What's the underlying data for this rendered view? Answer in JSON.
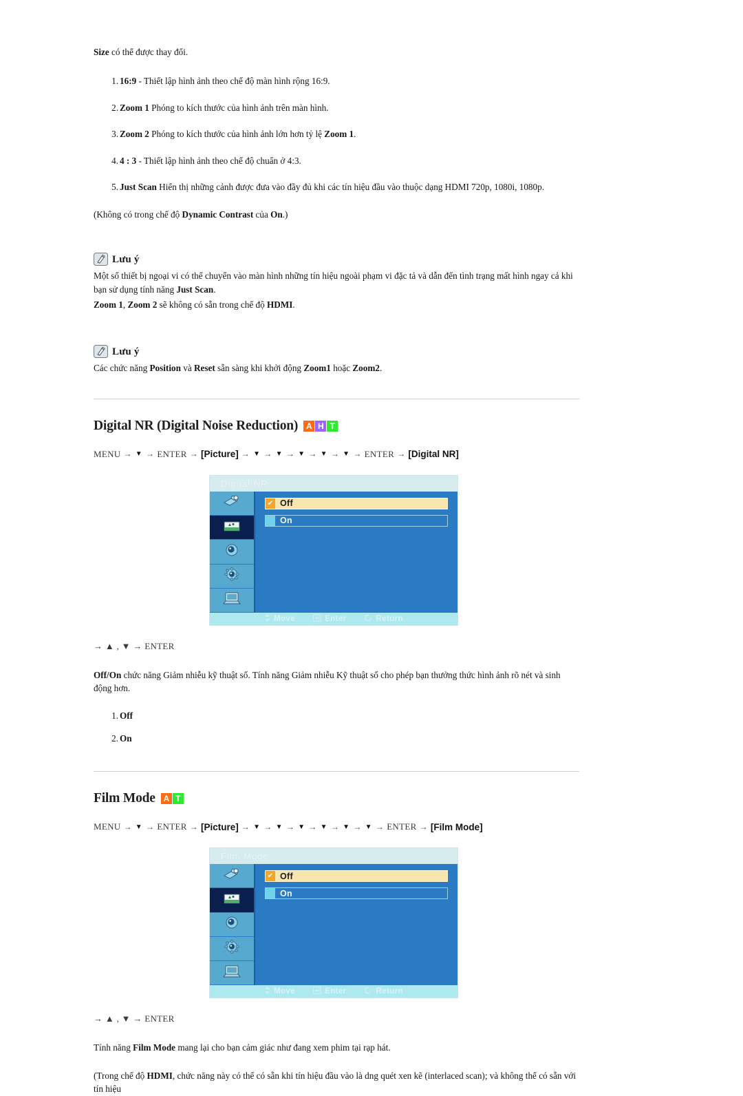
{
  "intro": {
    "lead_bold": "Size",
    "lead_rest": " có thể được thay đổi."
  },
  "size_options": [
    {
      "num": "1.",
      "bold": "16:9",
      "rest": " - Thiết lập hình ảnh theo chế độ màn hình rộng 16:9."
    },
    {
      "num": "2.",
      "bold": "Zoom 1",
      "rest": " Phóng to kích thước của hình ảnh trên màn hình."
    },
    {
      "num": "3.",
      "bold": "Zoom 2",
      "rest": " Phóng to kích thước của hình ảnh lớn hơn tỷ lệ ",
      "bold2": "Zoom 1",
      "rest2": "."
    },
    {
      "num": "4.",
      "bold": "4 : 3",
      "rest": " - Thiết lập hình ảnh theo chế độ chuẩn ở 4:3."
    },
    {
      "num": "5.",
      "bold": "Just Scan",
      "rest": " Hiển thị những cảnh được đưa vào đầy đủ khi các tín hiệu đầu vào thuộc dạng HDMI 720p, 1080i, 1080p."
    }
  ],
  "dynamic_note": {
    "pre": "(Không có trong chế độ ",
    "bold": "Dynamic Contrast",
    "mid": " của ",
    "bold2": "On",
    "post": ".)"
  },
  "notes": [
    {
      "title": "Lưu ý",
      "icon": "note-pencil-icon",
      "lines": [
        {
          "text": "Một số thiết bị ngoại vi có thể chuyển vào màn hình những tín hiệu ngoài phạm vi đặc tả và dẫn đến tình trạng mất hình ngay cả khi bạn sử dụng tính năng ",
          "bold": "Just Scan",
          "after": "."
        },
        {
          "bold_lead": "Zoom 1",
          "text": ", ",
          "bold_lead2": "Zoom 2",
          "text2": " sẽ không có sẵn trong chế độ ",
          "bold3": "HDMI",
          "after": "."
        }
      ]
    },
    {
      "title": "Lưu ý",
      "icon": "note-pencil-icon",
      "lines": [
        {
          "text": "Các chức năng ",
          "bold": "Position",
          "text2": " và ",
          "bold2": "Reset",
          "text3": " sẵn sàng khi khởi động ",
          "bold3": "Zoom1",
          "text4": " hoặc ",
          "bold4": "Zoom2",
          "after": "."
        }
      ]
    }
  ],
  "badge_colors": {
    "A": "#ff6a13",
    "H": "#9966ff",
    "T": "#2eea2e"
  },
  "sections": [
    {
      "id": "digital-nr",
      "heading": "Digital NR (Digital Noise Reduction)",
      "badges": [
        "A",
        "H",
        "T"
      ],
      "path": {
        "menu": "MENU",
        "enter": "ENTER",
        "bracket1": "[Picture]",
        "down_count": 5,
        "bracket2": "[Digital NR]"
      },
      "osd": {
        "title": "Digital  NR",
        "rail_icons": [
          "input-source-icon",
          "picture-icon",
          "sound-icon",
          "setup-gear-icon",
          "multi-control-icon"
        ],
        "rail_selected_index": 1,
        "options": [
          {
            "label": "Off",
            "selected": true
          },
          {
            "label": "On",
            "selected": false
          }
        ],
        "footer": [
          {
            "icon": "move-icon",
            "label": "Move"
          },
          {
            "icon": "enter-icon",
            "label": "Enter"
          },
          {
            "icon": "return-icon",
            "label": "Return"
          }
        ]
      },
      "key_hint": "→ ▲ , ▼ → ENTER",
      "desc": {
        "bold": "Off/On",
        "rest": " chức năng Giảm nhiễu kỹ thuật số. Tính năng Giảm nhiễu Kỹ thuật số cho phép bạn thưởng thức hình ảnh rõ nét và sinh động hơn."
      },
      "options_list": [
        {
          "num": "1.",
          "bold": "Off"
        },
        {
          "num": "2.",
          "bold": "On"
        }
      ]
    },
    {
      "id": "film-mode",
      "heading": "Film Mode",
      "badges": [
        "A",
        "T"
      ],
      "path": {
        "menu": "MENU",
        "enter": "ENTER",
        "bracket1": "[Picture]",
        "down_count": 6,
        "bracket2": "[Film Mode]"
      },
      "osd": {
        "title": "Film Mode",
        "rail_icons": [
          "input-source-icon",
          "picture-icon",
          "sound-icon",
          "setup-gear-icon",
          "multi-control-icon"
        ],
        "rail_selected_index": 1,
        "options": [
          {
            "label": "Off",
            "selected": true
          },
          {
            "label": "On",
            "selected": false
          }
        ],
        "footer": [
          {
            "icon": "move-icon",
            "label": "Move"
          },
          {
            "icon": "enter-icon",
            "label": "Enter"
          },
          {
            "icon": "return-icon",
            "label": "Return"
          }
        ]
      },
      "key_hint": "→ ▲ , ▼ → ENTER",
      "desc_film": {
        "pre": "Tính năng ",
        "bold": "Film Mode",
        "post": " mang lại cho bạn cảm giác như đang xem phim tại rạp hát."
      },
      "hdmi_note": {
        "pre": "(Trong chế độ ",
        "bold": "HDMI",
        "post": ", chức năng này có thể có sẵn khi tín hiệu đầu vào là dng quét xen kẽ (interlaced scan); và không thể có sẵn với tín hiệu"
      }
    }
  ]
}
